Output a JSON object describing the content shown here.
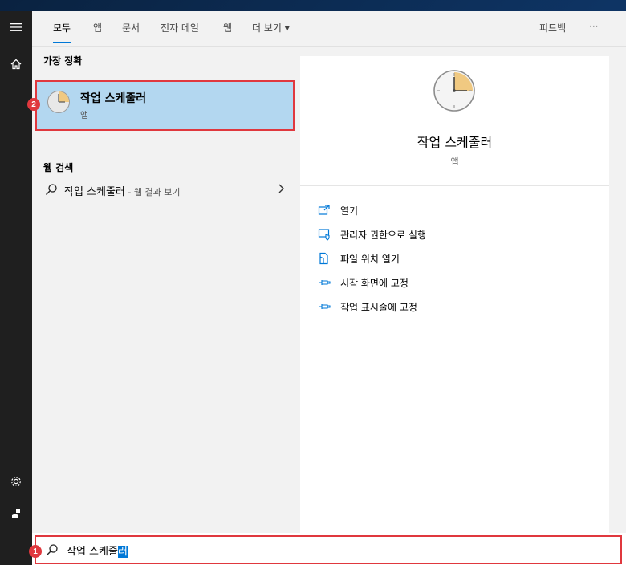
{
  "tabs": [
    {
      "label": "모두",
      "active": true
    },
    {
      "label": "앱"
    },
    {
      "label": "문서"
    },
    {
      "label": "전자 메일"
    },
    {
      "label": "웹"
    },
    {
      "label": "더 보기"
    }
  ],
  "more_caret": "▾",
  "feedback_label": "피드백",
  "more_options_label": "···",
  "sections": {
    "best_match_header": "가장 정확",
    "web_header": "웹 검색"
  },
  "best_match": {
    "title": "작업 스케줄러",
    "subtitle": "앱",
    "badge": "2"
  },
  "web_result": {
    "query": "작업 스케줄러",
    "hint": " - 웹 결과 보기"
  },
  "preview": {
    "title": "작업 스케줄러",
    "subtitle": "앱",
    "actions": [
      {
        "label": "열기",
        "icon": "open-icon"
      },
      {
        "label": "관리자 권한으로 실행",
        "icon": "run-as-admin-icon"
      },
      {
        "label": "파일 위치 열기",
        "icon": "file-location-icon"
      },
      {
        "label": "시작 화면에 고정",
        "icon": "pin-icon"
      },
      {
        "label": "작업 표시줄에 고정",
        "icon": "pin-icon"
      }
    ]
  },
  "search": {
    "text_before": "작업 스케줄",
    "text_selected": "러",
    "badge": "1"
  },
  "colors": {
    "accent": "#0078d7",
    "highlight": "#e0383e",
    "selection_bg": "#b3d7f0"
  }
}
